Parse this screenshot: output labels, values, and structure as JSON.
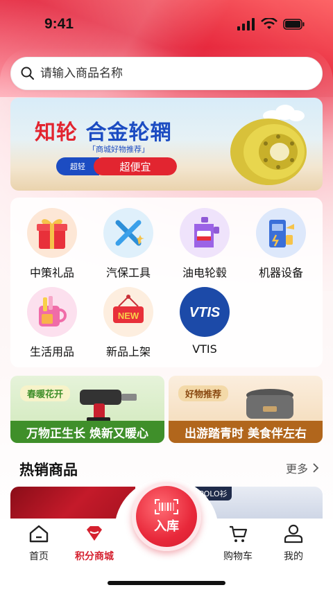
{
  "status_bar": {
    "time": "9:41"
  },
  "search": {
    "placeholder": "请输入商品名称"
  },
  "banner": {
    "title_part1": "知轮",
    "title_part2": "合金轮辋",
    "subtitle": "「商城好物推荐」",
    "pill_left": "超轻",
    "pill_right": "超便宜"
  },
  "categories": [
    {
      "label": "中策礼品",
      "icon": "gift-icon"
    },
    {
      "label": "汽保工具",
      "icon": "tools-icon"
    },
    {
      "label": "油电轮毂",
      "icon": "oil-can-icon"
    },
    {
      "label": "机器设备",
      "icon": "machine-icon"
    },
    {
      "label": "生活用品",
      "icon": "mug-icon"
    },
    {
      "label": "新品上架",
      "icon": "new-sign-icon",
      "sign_text": "NEW"
    },
    {
      "label": "VTIS",
      "icon": "vtis-logo",
      "logo_text": "VTIS"
    }
  ],
  "promos": [
    {
      "tag": "春暖花开",
      "text": "万物正生长 焕新又暖心",
      "accent": "#3f8f2a"
    },
    {
      "tag": "好物推荐",
      "text": "出游踏青时 美食伴左右",
      "accent": "#b1661c"
    }
  ],
  "hot": {
    "title": "热销商品",
    "more": "更多",
    "tag": "款POLO衫"
  },
  "fab": {
    "label": "入库"
  },
  "tabs": [
    {
      "label": "首页",
      "icon": "home-icon",
      "active": false
    },
    {
      "label": "积分商城",
      "icon": "gem-icon",
      "active": true
    },
    {
      "label": "购物车",
      "icon": "cart-icon",
      "active": false
    },
    {
      "label": "我的",
      "icon": "user-icon",
      "active": false
    }
  ],
  "colors": {
    "brand_red": "#e22530",
    "brand_blue": "#1c4cc2"
  }
}
